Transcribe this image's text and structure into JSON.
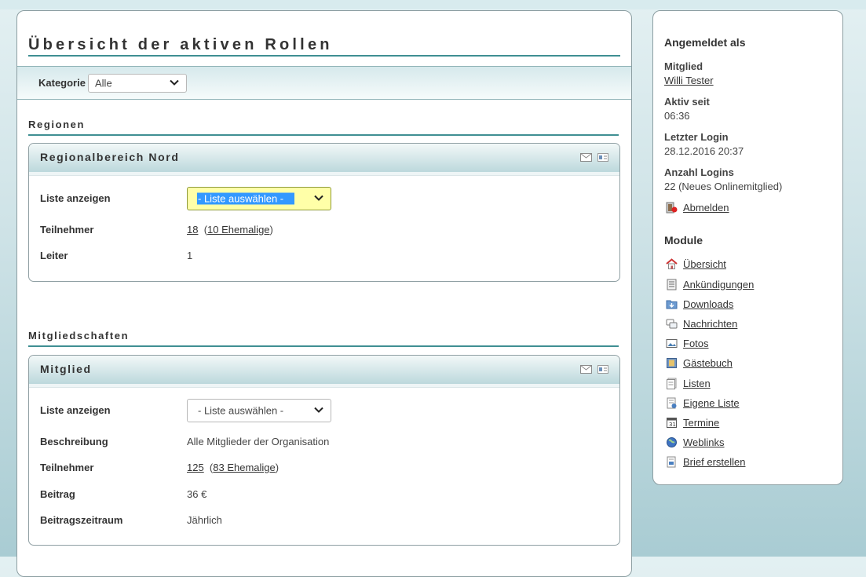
{
  "page": {
    "title": "Übersicht der aktiven Rollen"
  },
  "filter": {
    "label": "Kategorie",
    "selected": "Alle"
  },
  "sections": [
    {
      "heading": "Regionen",
      "card": {
        "title": "Regionalbereich Nord",
        "list_label": "Liste anzeigen",
        "list_select": "- Liste auswählen -",
        "participants_label": "Teilnehmer",
        "participants_count": "18",
        "former_members": "10 Ehemalige",
        "leader_label": "Leiter",
        "leader_count": "1"
      }
    },
    {
      "heading": "Mitgliedschaften",
      "card": {
        "title": "Mitglied",
        "list_label": "Liste anzeigen",
        "list_select": "- Liste auswählen -",
        "description_label": "Beschreibung",
        "description": "Alle Mitglieder der Organisation",
        "participants_label": "Teilnehmer",
        "participants_count": "125",
        "former_members": "83 Ehemalige",
        "fee_label": "Beitrag",
        "fee": "36 €",
        "period_label": "Beitragszeitraum",
        "period": "Jährlich"
      }
    }
  ],
  "sidebar": {
    "login_heading": "Angemeldet als",
    "member_label": "Mitglied",
    "member_name": "Willi Tester",
    "active_since_label": "Aktiv seit",
    "active_since": "06:36",
    "last_login_label": "Letzter Login",
    "last_login": "28.12.2016 20:37",
    "login_count_label": "Anzahl Logins",
    "login_count": "22 (Neues Onlinemitglied)",
    "logout": "Abmelden",
    "modules_heading": "Module",
    "modules": [
      {
        "label": "Übersicht",
        "icon": "home-icon"
      },
      {
        "label": "Ankündigungen",
        "icon": "announcements-icon"
      },
      {
        "label": "Downloads",
        "icon": "downloads-icon"
      },
      {
        "label": "Nachrichten",
        "icon": "messages-icon"
      },
      {
        "label": "Fotos",
        "icon": "photos-icon"
      },
      {
        "label": "Gästebuch",
        "icon": "guestbook-icon"
      },
      {
        "label": "Listen",
        "icon": "lists-icon"
      },
      {
        "label": "Eigene Liste",
        "icon": "own-list-icon"
      },
      {
        "label": "Termine",
        "icon": "calendar-icon"
      },
      {
        "label": "Weblinks",
        "icon": "globe-icon"
      },
      {
        "label": "Brief erstellen",
        "icon": "letter-icon"
      }
    ]
  },
  "colors": {
    "accent": "#3f8f93",
    "highlight_select": "#ffffa8",
    "selection": "#3399ff"
  }
}
